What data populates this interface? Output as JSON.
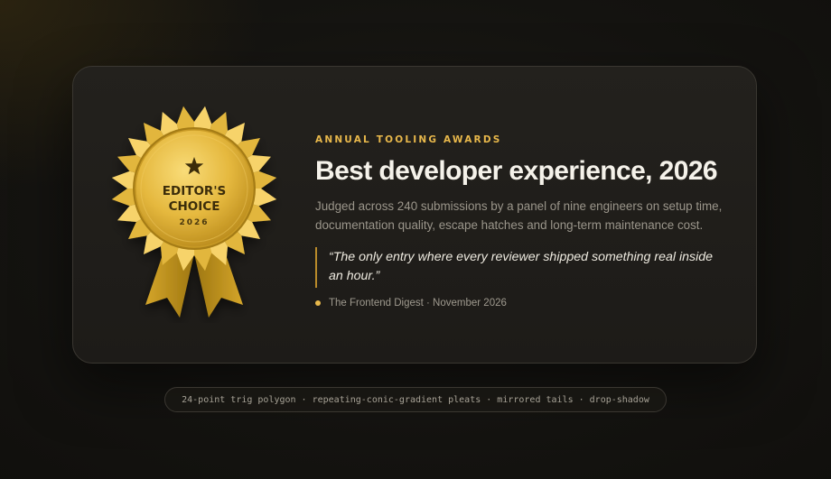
{
  "badge": {
    "icon": "star-icon",
    "line1": "EDITOR'S",
    "line2": "CHOICE",
    "year": "2026",
    "colors": {
      "gold_light": "#f7d36a",
      "gold_mid": "#e2b63c",
      "gold_dark": "#a07a12",
      "ribbon": "#c49a1e"
    }
  },
  "award": {
    "eyebrow": "ANNUAL TOOLING AWARDS",
    "title": "Best developer experience, 2026",
    "description": "Judged across 240 submissions by a panel of nine engineers on setup time, documentation quality, escape hatches and long-term maintenance cost.",
    "quote": "“The only entry where every reviewer shipped something real inside an hour.”",
    "source": "The Frontend Digest · November 2026"
  },
  "footer": {
    "caption": "24-point trig polygon · repeating-conic-gradient pleats · mirrored tails · drop-shadow"
  },
  "colors": {
    "accent": "#e8b84b",
    "background": "#141310",
    "card": "#211f1b"
  }
}
